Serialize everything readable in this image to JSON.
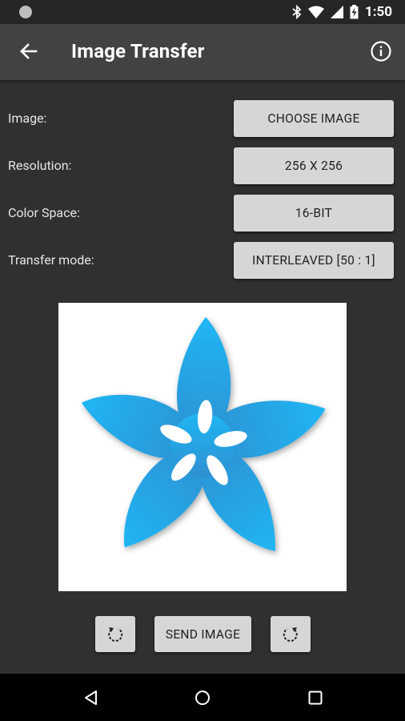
{
  "status_bar": {
    "time": "1:50",
    "icons": [
      "notification-dot-icon",
      "bluetooth-icon",
      "wifi-icon",
      "signal-icon",
      "battery-icon"
    ]
  },
  "app_bar": {
    "title": "Image Transfer",
    "back_icon": "arrow-back-icon",
    "info_icon": "info-icon"
  },
  "settings": [
    {
      "label": "Image:",
      "button": "CHOOSE IMAGE"
    },
    {
      "label": "Resolution:",
      "button": "256 X 256"
    },
    {
      "label": "Color Space:",
      "button": "16-BIT"
    },
    {
      "label": "Transfer mode:",
      "button": "INTERLEAVED [50 : 1]"
    }
  ],
  "preview": {
    "image": "adafruit-flower-logo",
    "colors": {
      "top": "#1fb6f5",
      "bottom": "#2f8fd0",
      "background": "#ffffff"
    }
  },
  "actions": {
    "rotate_left_icon": "rotate-left-icon",
    "send_label": "SEND IMAGE",
    "rotate_right_icon": "rotate-right-icon"
  },
  "nav_bar": {
    "icons": [
      "back-triangle-icon",
      "home-circle-icon",
      "recents-square-icon"
    ]
  },
  "colors": {
    "background": "#303030",
    "app_bar": "#424242",
    "button": "#d6d6d6"
  }
}
